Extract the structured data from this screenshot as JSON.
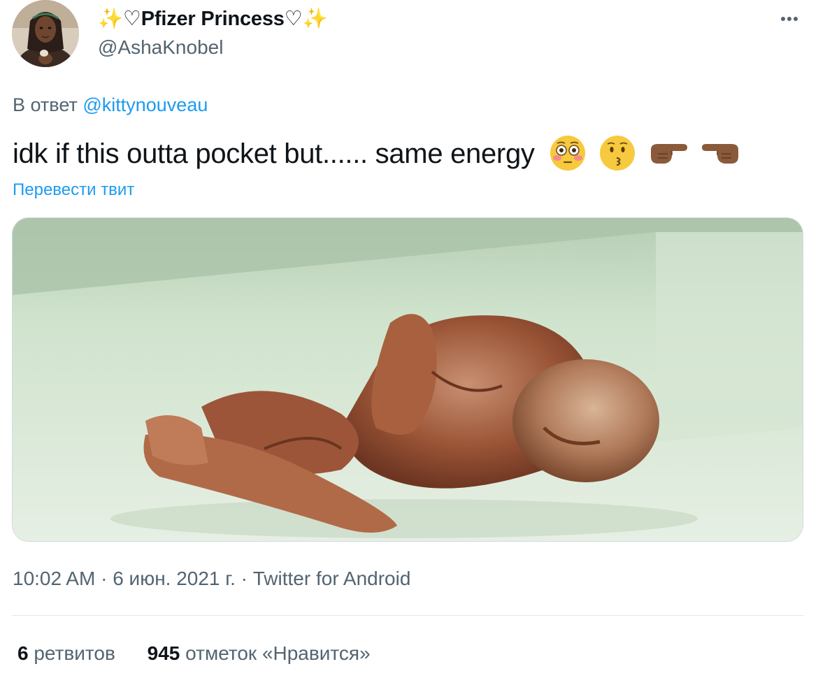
{
  "author": {
    "display_name_prefix": "✨",
    "display_name_heart_left": "♡",
    "display_name": "Pfizer Princess",
    "display_name_heart_right": "♡",
    "display_name_suffix": "✨",
    "handle": "@AshaKnobel",
    "avatar_icon": "avatar-portrait"
  },
  "more_icon": "more-horizontal-icon",
  "reply": {
    "prefix": "В ответ",
    "mention": "@kittynouveau"
  },
  "tweet": {
    "text": "idk if this outta pocket but...... same energy",
    "emojis": [
      "flushed-face-emoji",
      "kissing-face-emoji",
      "pointing-right-emoji",
      "pointing-left-emoji"
    ]
  },
  "translate_label": "Перевести твит",
  "media": {
    "kind": "photo"
  },
  "meta": {
    "time": "10:02 AM",
    "sep1": " · ",
    "date": "6 июн. 2021 г.",
    "sep2": " · ",
    "source": "Twitter for Android"
  },
  "stats": {
    "retweets_count": "6",
    "retweets_label": "ретвитов",
    "likes_count": "945",
    "likes_label": "отметок «Нравится»"
  },
  "colors": {
    "link": "#1d9bf0",
    "secondary_text": "#536471",
    "primary_text": "#0f1419",
    "sparkle": "#f5b73a"
  }
}
